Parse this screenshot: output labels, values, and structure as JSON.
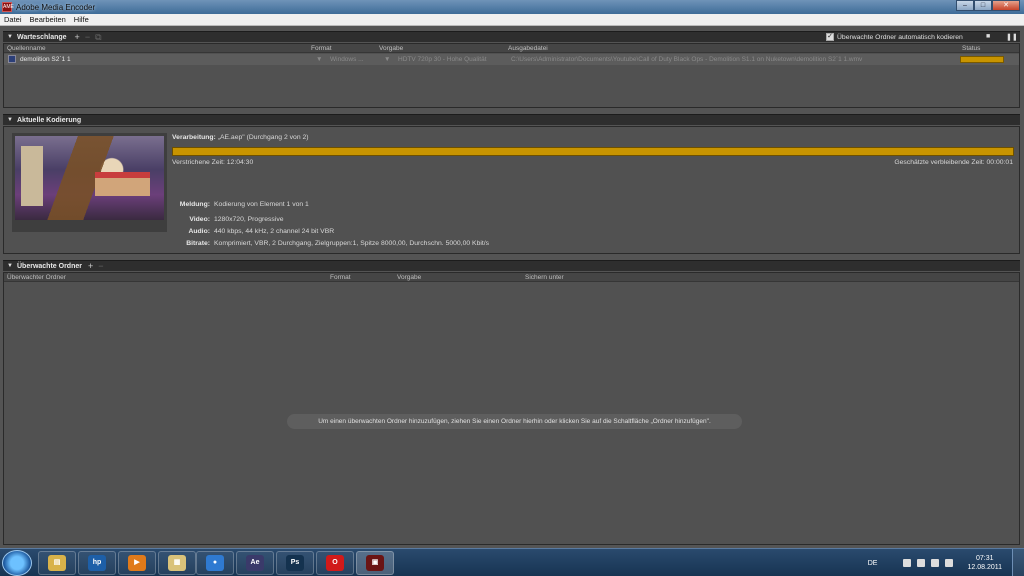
{
  "window": {
    "title": "Adobe Media Encoder",
    "app_icon": "AME",
    "min": "–",
    "max": "□",
    "close": "✕"
  },
  "menu": [
    "Datei",
    "Bearbeiten",
    "Hilfe"
  ],
  "queue": {
    "title": "Warteschlange",
    "add_btn": "+",
    "remove_btn": "−",
    "dup_btn": "⧉",
    "auto_encode_label": "Überwachte Ordner automatisch kodieren",
    "auto_encode_checked": "✓",
    "stop_btn": "■",
    "pause_btn": "❚❚",
    "columns": [
      "Quellenname",
      "Format",
      "Vorgabe",
      "Ausgabedatei",
      "Status"
    ],
    "rows": [
      {
        "source": "demolition S2`1 1",
        "format": "Windows ...",
        "preset": "HDTV 720p 30 - Hohe Qualität",
        "output": "C:\\Users\\Administrator\\Documents\\Youtube\\Call of Duty Black Ops - Demolition S1.1 on Nuketown\\demolition S2`1 1.wmv",
        "status_progress": 1.0
      }
    ]
  },
  "current": {
    "title": "Aktuelle Kodierung",
    "processing_label": "Verarbeitung:",
    "processing_value": "„AE.aep\" (Durchgang 2 von 2)",
    "progress": 1.0,
    "elapsed": "Verstrichene Zeit: 12:04:30",
    "remaining": "Geschätzte verbleibende Zeit: 00:00:01",
    "message_label": "Meldung:",
    "message_value": "Kodierung von Element 1 von 1",
    "video_label": "Video:",
    "video_value": "1280x720, Progressive",
    "audio_label": "Audio:",
    "audio_value": "440 kbps, 44 kHz, 2 channel 24 bit VBR",
    "bitrate_label": "Bitrate:",
    "bitrate_value": "Komprimiert, VBR, 2 Durchgang, Zielgruppen:1, Spitze 8000,00, Durchschn. 5000,00 Kbit/s"
  },
  "watch": {
    "title": "Überwachte Ordner",
    "add_btn": "+",
    "remove_btn": "−",
    "columns": [
      "Überwachter Ordner",
      "Format",
      "Vorgabe",
      "Sichern unter"
    ],
    "hint": "Um einen überwachten Ordner hinzuzufügen, ziehen Sie einen Ordner hierhin oder klicken Sie auf die Schaltfläche „Ordner hinzufügen\"."
  },
  "taskbar": {
    "apps": [
      {
        "icon": "explorer-icon",
        "glyph": "▤",
        "color": "#d8b24a"
      },
      {
        "icon": "hp-icon",
        "glyph": "hp",
        "color": "#1d5fa8"
      },
      {
        "icon": "media-player-icon",
        "glyph": "▶",
        "color": "#e07a1a"
      },
      {
        "icon": "folder-icon",
        "glyph": "▦",
        "color": "#d9c27a"
      },
      {
        "icon": "browser-globe-icon",
        "glyph": "●",
        "color": "#2f7ad1"
      },
      {
        "icon": "after-effects-icon",
        "glyph": "Ae",
        "color": "#3a3a6a"
      },
      {
        "icon": "photoshop-icon",
        "glyph": "Ps",
        "color": "#14324f"
      },
      {
        "icon": "opera-icon",
        "glyph": "O",
        "color": "#d11a1a"
      },
      {
        "icon": "media-encoder-icon",
        "glyph": "▣",
        "color": "#6a1414"
      }
    ],
    "lang": "DE",
    "time": "07:31",
    "date": "12.08.2011"
  }
}
